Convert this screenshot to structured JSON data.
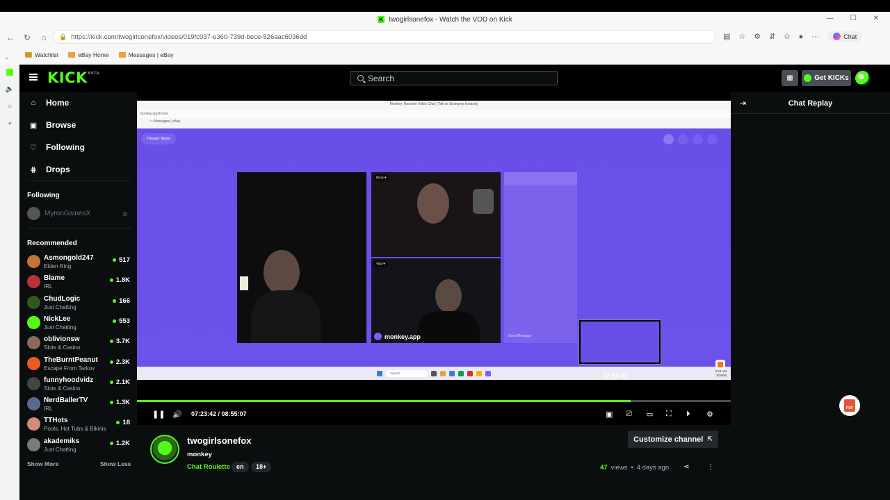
{
  "browser": {
    "tab_title": "twogirlsonefox - Watch the VOD on Kick",
    "url": "https://kick.com/twogirlsonefox/videos/019fc037-e360-739d-bece-526aac6036dd",
    "chat_label": "Chat",
    "bookmarks": [
      "Watchlist",
      "eBay Home",
      "Messages | eBay"
    ]
  },
  "header": {
    "logo": "KICK",
    "logo_badge": "BETA",
    "search_placeholder": "Search",
    "get_kicks": "Get KICKs"
  },
  "sidebar": {
    "nav": [
      {
        "label": "Home",
        "icon": "home-icon"
      },
      {
        "label": "Browse",
        "icon": "browse-icon"
      },
      {
        "label": "Following",
        "icon": "heart-icon"
      },
      {
        "label": "Drops",
        "icon": "drops-icon"
      }
    ],
    "following_title": "Following",
    "following_offline": "MyronGainesX",
    "recommended_title": "Recommended",
    "channels": [
      {
        "name": "Asmongold247",
        "category": "Elden Ring",
        "viewers": "517",
        "color": "#c2733a"
      },
      {
        "name": "Blame",
        "category": "IRL",
        "viewers": "1.8K",
        "color": "#b8323c"
      },
      {
        "name": "ChudLogic",
        "category": "Just Chatting",
        "viewers": "166",
        "color": "#2e5a1e"
      },
      {
        "name": "NickLee",
        "category": "Just Chatting",
        "viewers": "553",
        "color": "#53fc18"
      },
      {
        "name": "oblivionsw",
        "category": "Slots & Casino",
        "viewers": "3.7K",
        "color": "#8a6a5a"
      },
      {
        "name": "TheBurntPeanut",
        "category": "Escape From Tarkov",
        "viewers": "2.3K",
        "color": "#e85a1e"
      },
      {
        "name": "funnyhoodvidz",
        "category": "Slots & Casino",
        "viewers": "2.1K",
        "color": "#444444"
      },
      {
        "name": "NerdBallerTV",
        "category": "IRL",
        "viewers": "1.3K",
        "color": "#5a6a8a"
      },
      {
        "name": "TTHots",
        "category": "Pools, Hot Tubs & Bikinis",
        "viewers": "18",
        "color": "#d48a7a"
      },
      {
        "name": "akademiks",
        "category": "Just Chatting",
        "viewers": "1.2K",
        "color": "#7a7a7a"
      }
    ],
    "show_more": "Show More",
    "show_less": "Show Less"
  },
  "player": {
    "inner_tab_title": "Monkey: Random Video Chat | Talk to Strangers Instantly",
    "theater_mode": "Theater Mode",
    "monkey_app": "monkey.app",
    "send_message": "Send Message",
    "preview_time": "07:15:01",
    "current_time": "07:23:42",
    "total_time": "08:55:07",
    "time_separator": " / ",
    "progress_fraction": 0.831
  },
  "chat": {
    "title": "Chat Replay"
  },
  "info": {
    "streamer": "twogirlsonefox",
    "stream_title": "monkey",
    "category": "Chat Roulette",
    "tags": [
      "en",
      "18+"
    ],
    "customize": "Customize channel",
    "views_num": "47",
    "views_label": "views",
    "bullet": "•",
    "ago": "4 days ago"
  },
  "colors": {
    "kick_green": "#53fc18",
    "page_bg": "#0b0e0f",
    "monkey_purple": "#6b4fe0"
  }
}
